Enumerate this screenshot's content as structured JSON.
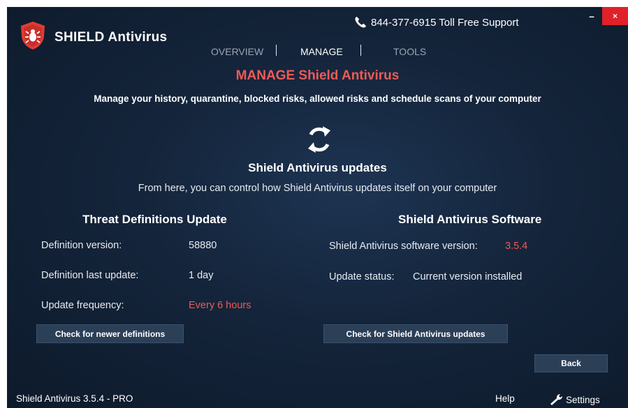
{
  "app": {
    "title": "SHIELD Antivirus",
    "support_phone": "844-377-6915 Toll Free Support",
    "minimize_label": "–",
    "close_label": "×"
  },
  "nav": {
    "tabs": [
      {
        "label": "OVERVIEW",
        "active": false
      },
      {
        "label": "MANAGE",
        "active": true
      },
      {
        "label": "TOOLS",
        "active": false
      }
    ],
    "separator": "|"
  },
  "manage": {
    "heading": "MANAGE Shield Antivirus",
    "description": "Manage your history, quarantine, blocked risks, allowed risks and schedule scans of your computer"
  },
  "updates": {
    "icon": "refresh-icon",
    "title": "Shield Antivirus updates",
    "description": "From here, you can control how Shield Antivirus updates itself on your computer"
  },
  "threat": {
    "title": "Threat Definitions Update",
    "rows": [
      {
        "label": "Definition version:",
        "value": "58880"
      },
      {
        "label": "Definition last update:",
        "value": "1 day"
      },
      {
        "label": "Update frequency:",
        "value": "Every 6 hours"
      }
    ],
    "button": "Check for newer definitions"
  },
  "software": {
    "title": "Shield Antivirus Software",
    "version_label": "Shield Antivirus software version:",
    "version_value": "3.5.4",
    "status_label": "Update status:",
    "status_value": "Current version installed",
    "button": "Check for Shield Antivirus updates"
  },
  "back_button": "Back",
  "footer": {
    "version": "Shield Antivirus 3.5.4 - PRO",
    "help": "Help",
    "settings": "Settings"
  },
  "colors": {
    "accent_red": "#f05a55",
    "close_red": "#e1212a",
    "background": "#14243a",
    "button": "#2b3f57"
  }
}
